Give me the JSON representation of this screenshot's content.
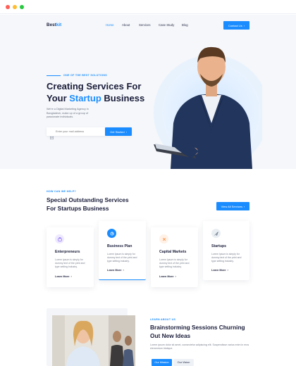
{
  "colors": {
    "accent": "#1a8cff",
    "dark": "#1a1d3a",
    "muted": "#6c7280",
    "hero_bg": "#f5f7fa"
  },
  "window_controls": [
    {
      "name": "close-dot",
      "color": "#ff5f57"
    },
    {
      "name": "minimize-dot",
      "color": "#febc2e"
    },
    {
      "name": "maximize-dot",
      "color": "#28c840"
    }
  ],
  "header": {
    "logo_main": "Best",
    "logo_accent": "kit",
    "nav": [
      "Home",
      "About",
      "Services",
      "Case Study",
      "Blog"
    ],
    "active_nav": "Home",
    "cta_label": "Contact Us",
    "cta_icon": "arrow-right-icon"
  },
  "hero": {
    "eyebrow": "ONE OF THE BEST SOLUTIONS",
    "title_line1": "Creating Services For",
    "title_line2_pre": "Your ",
    "title_line2_accent": "Startup",
    "title_line2_post": " Business",
    "description": "We're a Digital Marketing Agency in Bangladesh, make up of a group of passionate individuals.",
    "email_placeholder": "Enter your mail address",
    "email_icon": "mail-icon",
    "submit_label": "Get Started",
    "submit_icon": "arrow-right-icon"
  },
  "services": {
    "eyebrow": "HOW CAN WE HELP?",
    "title_line1": "Special Outstanding Services",
    "title_line2": "For Startups Business",
    "all_label": "View All Services",
    "cards": [
      {
        "title": "Enterpreneurs",
        "icon": "briefcase-icon",
        "text": "Lorem Ipsum is simply for dummy text of the print and type setting industry.",
        "link": "Learn More"
      },
      {
        "title": "Business Plan",
        "icon": "chart-icon",
        "text": "Lorem Ipsum is simply for dummy text of the print and type setting industry.",
        "link": "Learn More"
      },
      {
        "title": "Capital Markets",
        "icon": "sparkle-icon",
        "text": "Lorem Ipsum is simply for dummy text of the print and type setting industry.",
        "link": "Learn More"
      },
      {
        "title": "Startups",
        "icon": "rocket-icon",
        "text": "Lorem Ipsum is simply for dummy text of the print and type setting industry.",
        "link": "Learn More"
      }
    ]
  },
  "about": {
    "eyebrow": "LEARN ABOUT US",
    "title_line1": "Brainstorming Sessions Churning",
    "title_line2": "Out New Ideas",
    "description": "Lorem ipsum dolor sit amet, consectetur adipiscing elit. Suspendisse varius enim in eros elementum tristique.",
    "tabs": [
      "Our Mission",
      "Our Vision"
    ],
    "active_tab": "Our Mission"
  }
}
